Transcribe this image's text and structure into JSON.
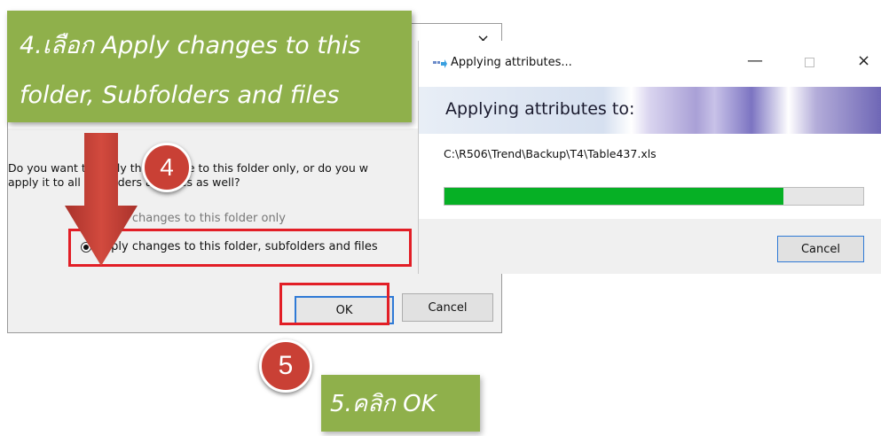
{
  "confirm_dialog": {
    "close_glyph": "×",
    "question_line1": "Do you want to apply this change to this folder only, or do you w",
    "question_line2": "apply it to all subfolders and files as well?",
    "option_folder_only": "Apply changes to this folder only",
    "option_all": "Apply changes to this folder, subfolders and files",
    "selected_option": "option_all",
    "ok_label": "OK",
    "cancel_label": "Cancel"
  },
  "callouts": {
    "step4_line1": "4.เลือก Apply changes to this",
    "step4_line2": "folder, Subfolders and files",
    "step5_text": "5.คลิก OK",
    "step4_number": "4",
    "step5_number": "5"
  },
  "progress_dialog": {
    "title": "Applying attributes...",
    "min_glyph": "—",
    "close_glyph": "×",
    "heading": "Applying attributes to:",
    "file_path": "C:\\R506\\Trend\\Backup\\T4\\Table437.xls",
    "progress_fraction": 0.81,
    "cancel_label": "Cancel"
  },
  "colors": {
    "callout_green": "#8fb04b",
    "highlight_red": "#e21e26",
    "step_circle": "#c94035",
    "progress_green": "#06b025",
    "focus_blue": "#2f7ad6"
  }
}
